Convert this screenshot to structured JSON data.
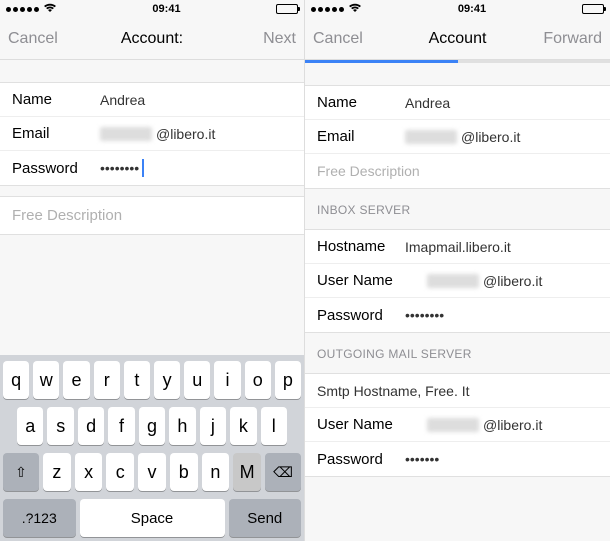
{
  "status": {
    "time": "09:41"
  },
  "left": {
    "nav": {
      "cancel": "Cancel",
      "title": "Account:",
      "next": "Next"
    },
    "fields": {
      "name_label": "Name",
      "name_value": "Andrea",
      "email_label": "Email",
      "email_suffix": "@libero.it",
      "password_label": "Password",
      "password_value": "••••••••",
      "desc_placeholder": "Free Description"
    },
    "keyboard": {
      "row1": [
        "q",
        "w",
        "e",
        "r",
        "t",
        "y",
        "u",
        "i",
        "o",
        "p"
      ],
      "row2": [
        "a",
        "s",
        "d",
        "f",
        "g",
        "h",
        "j",
        "k",
        "l"
      ],
      "row3": [
        "z",
        "x",
        "c",
        "v",
        "b",
        "n",
        "m"
      ],
      "shift": "⇧",
      "backspace": "⌫",
      "num": ".?123",
      "space": "Space",
      "send": "Send"
    }
  },
  "right": {
    "nav": {
      "cancel": "Cancel",
      "title": "Account",
      "forward": "Forward"
    },
    "fields": {
      "name_label": "Name",
      "name_value": "Andrea",
      "email_label": "Email",
      "email_suffix": "@libero.it",
      "desc_placeholder": "Free Description"
    },
    "inbox": {
      "header": "INBOX SERVER",
      "host_label": "Hostname",
      "host_value": "Imapmail.libero.it",
      "user_label": "User Name",
      "user_suffix": "@libero.it",
      "pw_label": "Password",
      "pw_value": "••••••••"
    },
    "outgoing": {
      "header": "OUTGOING MAIL SERVER",
      "smtp_label": "Smtp Hostname, Free. It",
      "user_label": "User Name",
      "user_suffix": "@libero.it",
      "pw_label": "Password",
      "pw_value": "•••••••"
    }
  }
}
